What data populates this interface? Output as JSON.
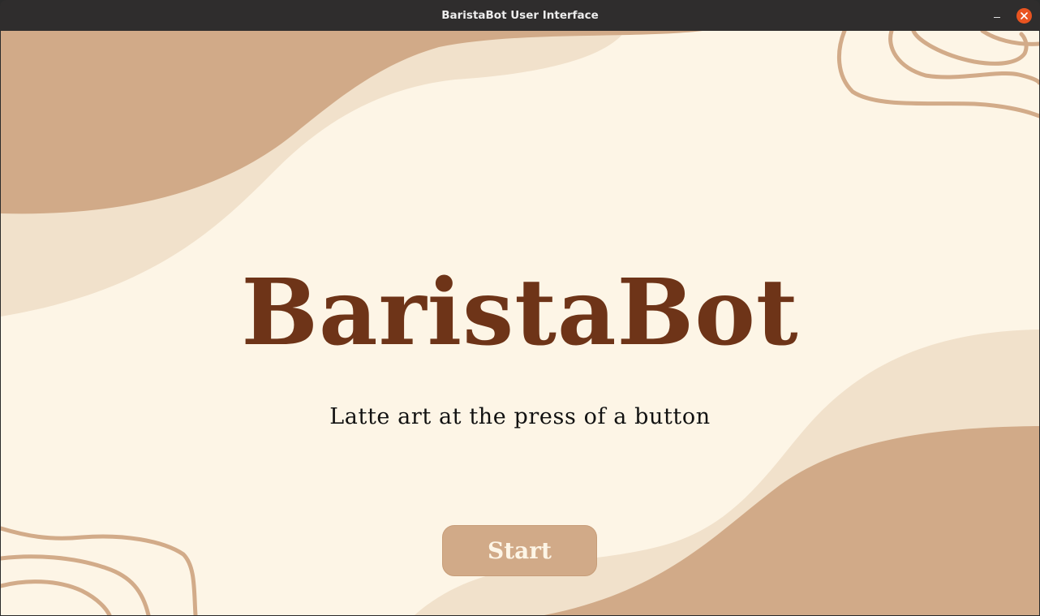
{
  "window": {
    "title": "BaristaBot User Interface"
  },
  "main": {
    "title": "BaristaBot",
    "tagline": "Latte art at the press of a button",
    "start_label": "Start"
  },
  "colors": {
    "background": "#fdf5e6",
    "shape_dark": "#d1aa88",
    "shape_light": "#f1e1cb",
    "line": "#d2ab89",
    "title": "#6e3418",
    "close_button": "#e95420"
  },
  "icons": {
    "minimize": "minimize-icon",
    "close": "close-icon"
  }
}
